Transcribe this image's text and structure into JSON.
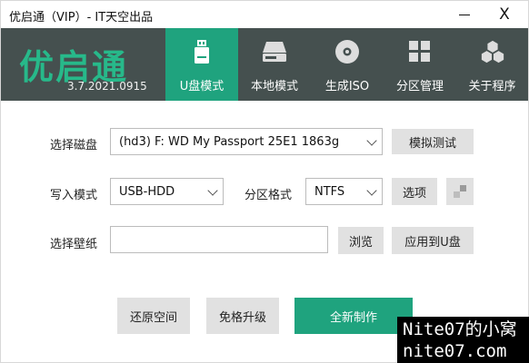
{
  "window": {
    "title": "优启通（VIP）- IT天空出品",
    "minimize_symbol": "—",
    "close_symbol": "X"
  },
  "header": {
    "logo_text": "优启通",
    "version": "3.7.2021.0915",
    "nav": [
      {
        "label": "U盘模式",
        "icon": "usb-drive-icon",
        "active": true
      },
      {
        "label": "本地模式",
        "icon": "hard-disk-icon",
        "active": false
      },
      {
        "label": "生成ISO",
        "icon": "disc-icon",
        "active": false
      },
      {
        "label": "分区管理",
        "icon": "partition-grid-icon",
        "active": false
      },
      {
        "label": "关于程序",
        "icon": "hexagon-cluster-icon",
        "active": false
      }
    ],
    "colors": {
      "background": "#45504f",
      "accent": "#1fa37e",
      "logo": "#27b98a"
    }
  },
  "form": {
    "disk_label": "选择磁盘",
    "disk_value": "(hd3) F: WD My Passport 25E1 1863g",
    "simulate_test_button": "模拟测试",
    "write_mode_label": "写入模式",
    "write_mode_value": "USB-HDD",
    "partition_format_label": "分区格式",
    "partition_format_value": "NTFS",
    "options_button": "选项",
    "wallpaper_label": "选择壁纸",
    "wallpaper_value": "",
    "browse_button": "浏览",
    "apply_to_usb_button": "应用到U盘"
  },
  "actions": {
    "restore_space_button": "还原空间",
    "upgrade_button": "免格升级",
    "create_button": "全新制作"
  },
  "watermark": {
    "line1": "Nite07的小窝",
    "line2": "nite07.com"
  }
}
